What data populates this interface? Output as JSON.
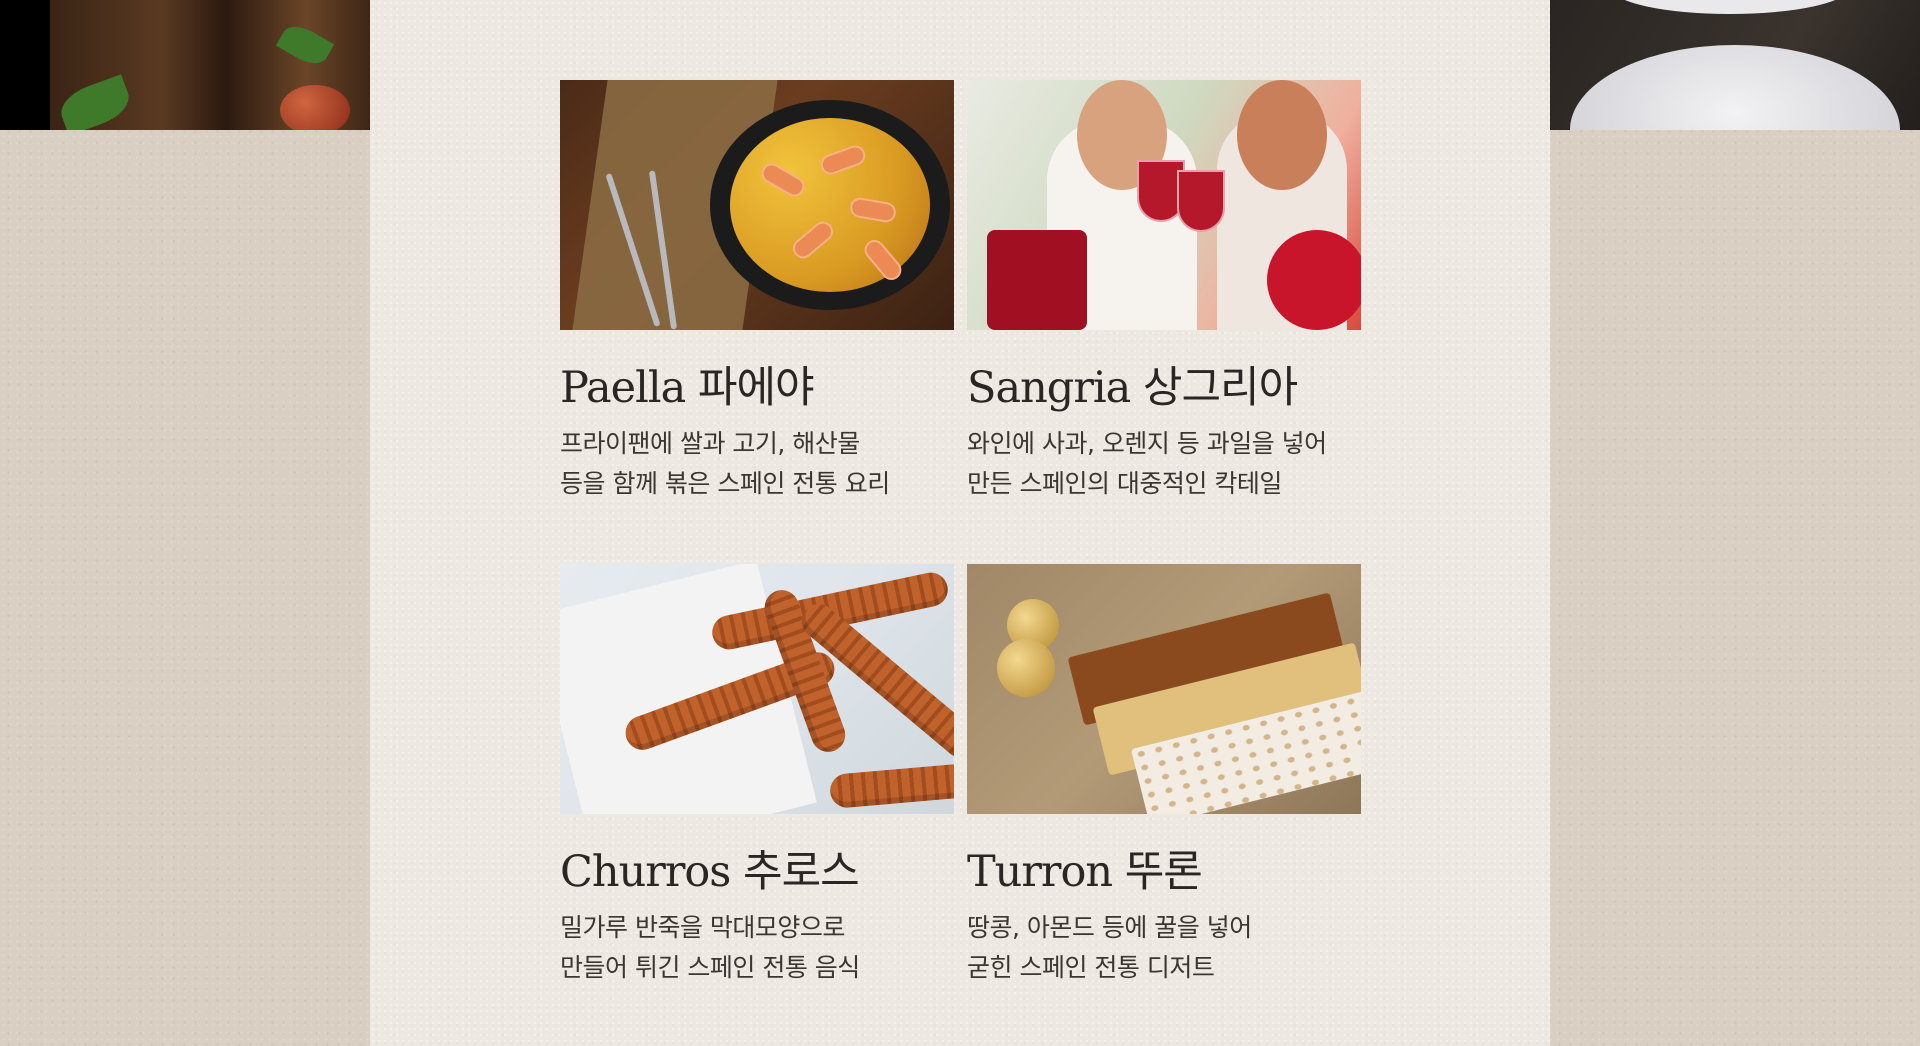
{
  "menu": {
    "items": [
      {
        "title": "Paella 파에야",
        "desc_lines": [
          "프라이팬에 쌀과 고기, 해산물",
          "등을 함께 볶은 스페인 전통 요리"
        ],
        "image": "paella-photo"
      },
      {
        "title": "Sangria 상그리아",
        "desc_lines": [
          "와인에 사과, 오렌지 등 과일을 넣어",
          "만든 스페인의 대중적인 칵테일"
        ],
        "image": "sangria-photo"
      },
      {
        "title": "Churros 추로스",
        "desc_lines": [
          "밀가루 반죽을 막대모양으로",
          "만들어 튀긴 스페인 전통 음식"
        ],
        "image": "churros-photo"
      },
      {
        "title": "Turron 뚜론",
        "desc_lines": [
          "땅콩, 아몬드 등에 꿀을 넣어",
          "굳힌 스페인 전통 디저트"
        ],
        "image": "turron-photo"
      }
    ]
  },
  "colors": {
    "background": "#d9cfc2",
    "paper": "#eee8e2",
    "text": "#2a2623"
  }
}
